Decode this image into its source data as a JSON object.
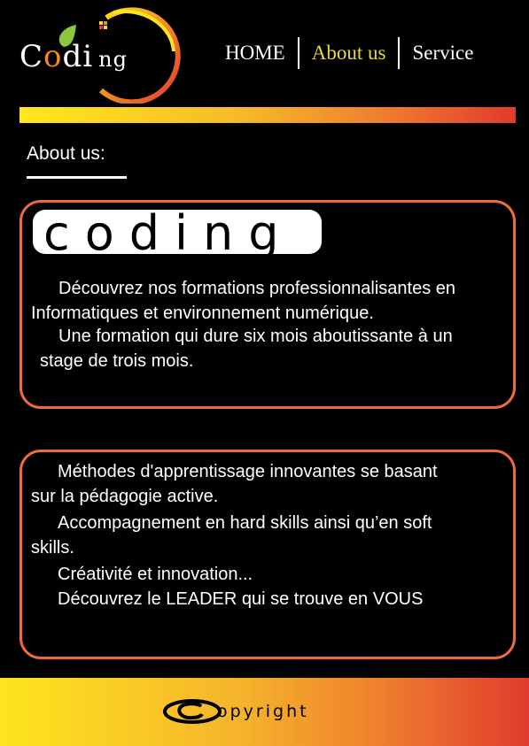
{
  "logo": {
    "parts": [
      "C",
      "o",
      "d",
      "i",
      "ng"
    ]
  },
  "nav": {
    "items": [
      {
        "label": "HOME",
        "active": false
      },
      {
        "label": "About us",
        "active": true
      },
      {
        "label": "Service",
        "active": false
      }
    ]
  },
  "section": {
    "title": "About us:"
  },
  "card1": {
    "brand": "coding",
    "lines": [
      "Découvrez nos formations professionnalisantes en",
      "Informatiques et environnement numérique.",
      "Une formation qui dure six mois aboutissante à un",
      "stage de trois mois."
    ]
  },
  "card2": {
    "lines": [
      "Méthodes d'apprentissage innovantes se basant",
      "sur la pédagogie active.",
      "Accompagnement en hard skills ainsi qu’en soft",
      "skills.",
      "Créativité et innovation...",
      "Découvrez le LEADER qui se trouve en VOUS"
    ]
  },
  "footer": {
    "copyright": "opyright"
  },
  "colors": {
    "accent_yellow": "#e8d93c",
    "card_border": "#ef6b3d",
    "logo_green": "#8cc63f"
  }
}
